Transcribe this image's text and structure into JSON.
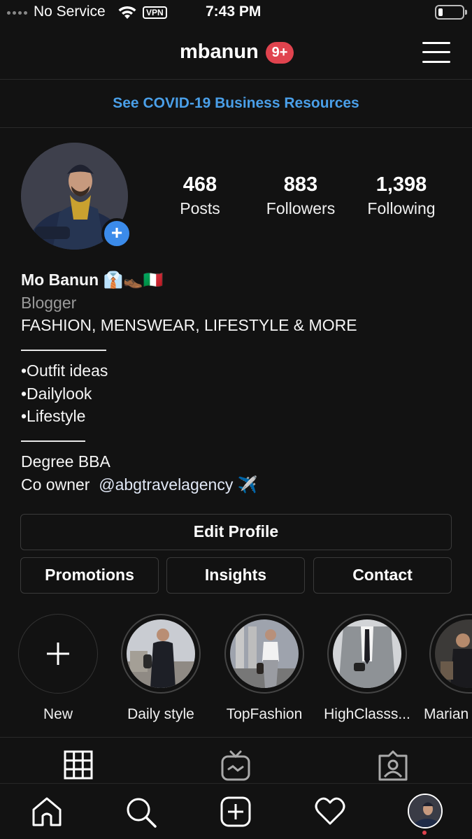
{
  "status_bar": {
    "carrier": "No Service",
    "vpn_label": "VPN",
    "time": "7:43 PM"
  },
  "header": {
    "username": "mbanun",
    "notification_badge": "9+",
    "badge_color": "#e0434e"
  },
  "banner": {
    "text": "See COVID-19 Business Resources",
    "color": "#4a9fe8"
  },
  "stats": {
    "posts": {
      "value": "468",
      "label": "Posts"
    },
    "followers": {
      "value": "883",
      "label": "Followers"
    },
    "following": {
      "value": "1,398",
      "label": "Following"
    }
  },
  "bio": {
    "name": "Mo Banun 👔👞🇮🇹",
    "category": "Blogger",
    "tagline": "FASHION, MENSWEAR, LIFESTYLE & MORE",
    "list": [
      "•Outfit ideas",
      "•Dailylook",
      "•Lifestyle"
    ],
    "degree": "Degree BBA",
    "owner_prefix": "Co owner  ",
    "owner_mention": "@abgtravelagency",
    "owner_suffix": " ✈️"
  },
  "buttons": {
    "edit_profile": "Edit Profile",
    "promotions": "Promotions",
    "insights": "Insights",
    "contact": "Contact"
  },
  "highlights": [
    {
      "label": "New",
      "icon": "plus-icon"
    },
    {
      "label": "Daily style"
    },
    {
      "label": "TopFashion"
    },
    {
      "label": "HighClasss..."
    },
    {
      "label": "Marian"
    }
  ],
  "tabs": [
    {
      "icon": "grid-icon"
    },
    {
      "icon": "igtv-icon"
    },
    {
      "icon": "tagged-icon"
    }
  ],
  "bottom_nav": [
    {
      "icon": "home-icon"
    },
    {
      "icon": "search-icon"
    },
    {
      "icon": "add-post-icon"
    },
    {
      "icon": "heart-icon"
    },
    {
      "icon": "profile-avatar"
    }
  ],
  "colors": {
    "background": "#121212",
    "accent_blue": "#3b8bea"
  }
}
